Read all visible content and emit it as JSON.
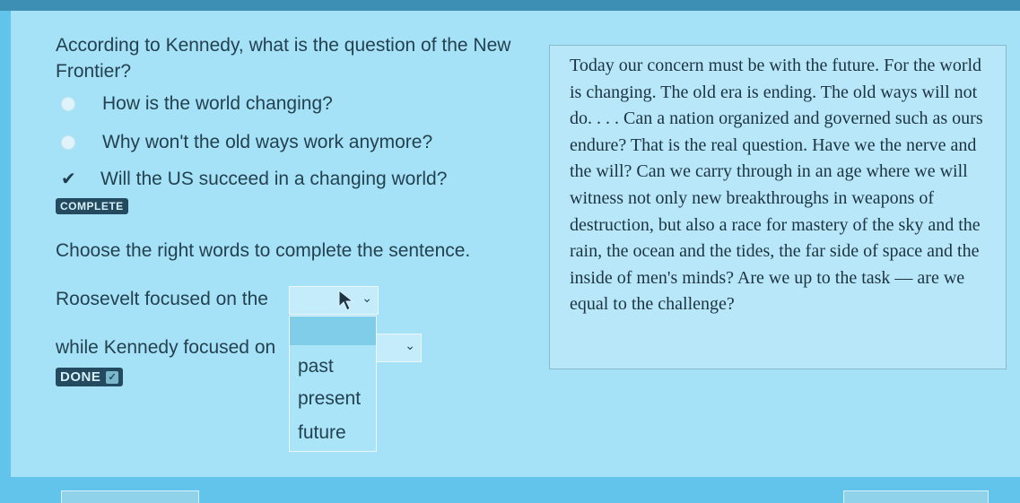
{
  "question": {
    "text": "According to Kennedy, what is the question of the New Frontier?",
    "options": [
      {
        "label": "How is the world changing?",
        "selected": false
      },
      {
        "label": "Why won't the old ways work anymore?",
        "selected": false
      },
      {
        "label": "Will the US succeed in a changing world?",
        "selected": true
      }
    ],
    "status_badge": "COMPLETE"
  },
  "sentence": {
    "instruction": "Choose the right words to complete the sentence.",
    "part1": "Roosevelt focused on the",
    "part2": "while Kennedy focused on",
    "dropdown_options": [
      "past",
      "present",
      "future"
    ],
    "done_label": "DONE"
  },
  "passage": {
    "text": "Today our concern must be with the future. For the world is changing. The old era is ending. The old ways will not do. . . . Can a nation organized and governed such as ours endure? That is the real question. Have we the nerve and the will? Can we carry through in an age where we will witness not only new breakthroughs in weapons of destruction, but also a race for mastery of the sky and the rain, the ocean and the tides, the far side of space and the inside of men's minds? Are we up to the task — are we equal to the challenge?"
  },
  "icons": {
    "check": "✔",
    "chevron": "⌄",
    "done_check": "✓"
  },
  "colors": {
    "background": "#62c4ea",
    "panel": "#a6e2f7",
    "badge": "#234a5e",
    "passage_bg": "#b7e7f8"
  }
}
